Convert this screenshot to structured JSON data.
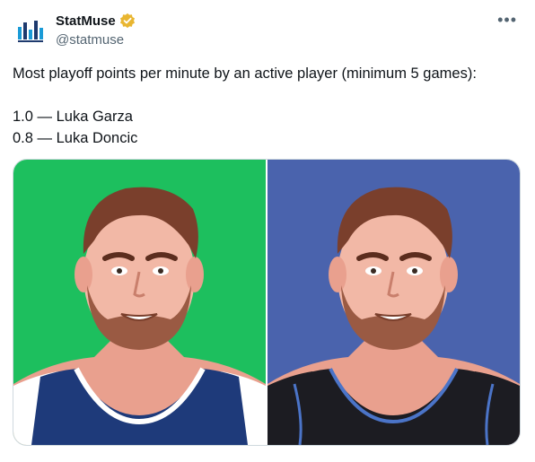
{
  "author": {
    "display_name": "StatMuse",
    "handle": "@statmuse",
    "verified_icon": "verified-badge-icon",
    "avatar_icon": "statmuse-logo-icon"
  },
  "tweet": {
    "lines": [
      "Most playoff points per minute by an active player (minimum 5 games):",
      "",
      "1.0 — Luka Garza",
      "0.8 — Luka Doncic"
    ]
  },
  "more_icon": "more-options-icon",
  "media": [
    {
      "name": "player-image-luka-garza",
      "background": "#1dbf5e",
      "jersey": "#1e3a7a",
      "trim": "#ffffff"
    },
    {
      "name": "player-image-luka-doncic",
      "background": "#4a63ad",
      "jersey": "#1c1c22",
      "trim": "#4b74c8"
    }
  ],
  "colors": {
    "verified_gold": "#e9b631",
    "logo_blue": "#1a9bd7",
    "logo_dark": "#1e3a6e"
  }
}
